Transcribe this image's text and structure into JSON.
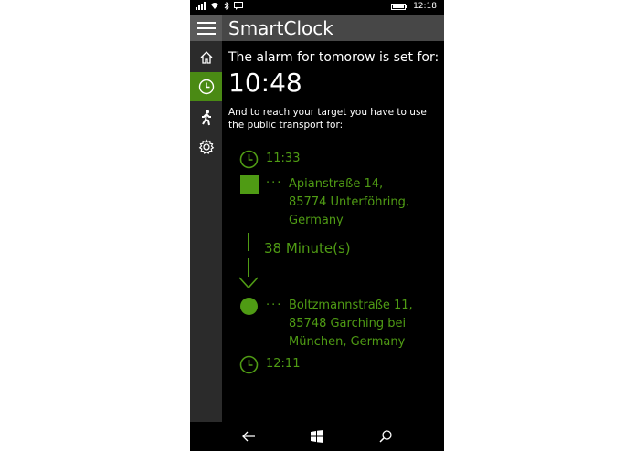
{
  "status": {
    "time": "12:18"
  },
  "header": {
    "title": "SmartClock"
  },
  "sidebar": {
    "items": [
      {
        "icon": "home-icon",
        "active": false
      },
      {
        "icon": "clock-icon",
        "active": true
      },
      {
        "icon": "walking-person-icon",
        "active": false
      },
      {
        "icon": "gear-icon",
        "active": false
      }
    ]
  },
  "main": {
    "alarm_label": "The alarm for tomorow is set for:",
    "alarm_time": "10:48",
    "transport_label": "And to reach your target you have to use the public transport for:",
    "route": {
      "departure_time": "11:33",
      "origin_line1": "Apianstraße 14,",
      "origin_line2": "85774 Unterföhring,",
      "origin_line3": "Germany",
      "duration": "38 Minute(s)",
      "destination_line1": "Boltzmannstraße 11,",
      "destination_line2": "85748 Garching bei",
      "destination_line3": "München, Germany",
      "arrival_time": "12:11",
      "dots": "···"
    }
  },
  "colors": {
    "accent": "#4f9b14",
    "header_bg": "#474747",
    "sidebar_bg": "#2b2b2b",
    "background": "#000000"
  },
  "bottom_nav": [
    {
      "icon": "back-arrow-icon"
    },
    {
      "icon": "windows-logo-icon"
    },
    {
      "icon": "search-icon"
    }
  ]
}
